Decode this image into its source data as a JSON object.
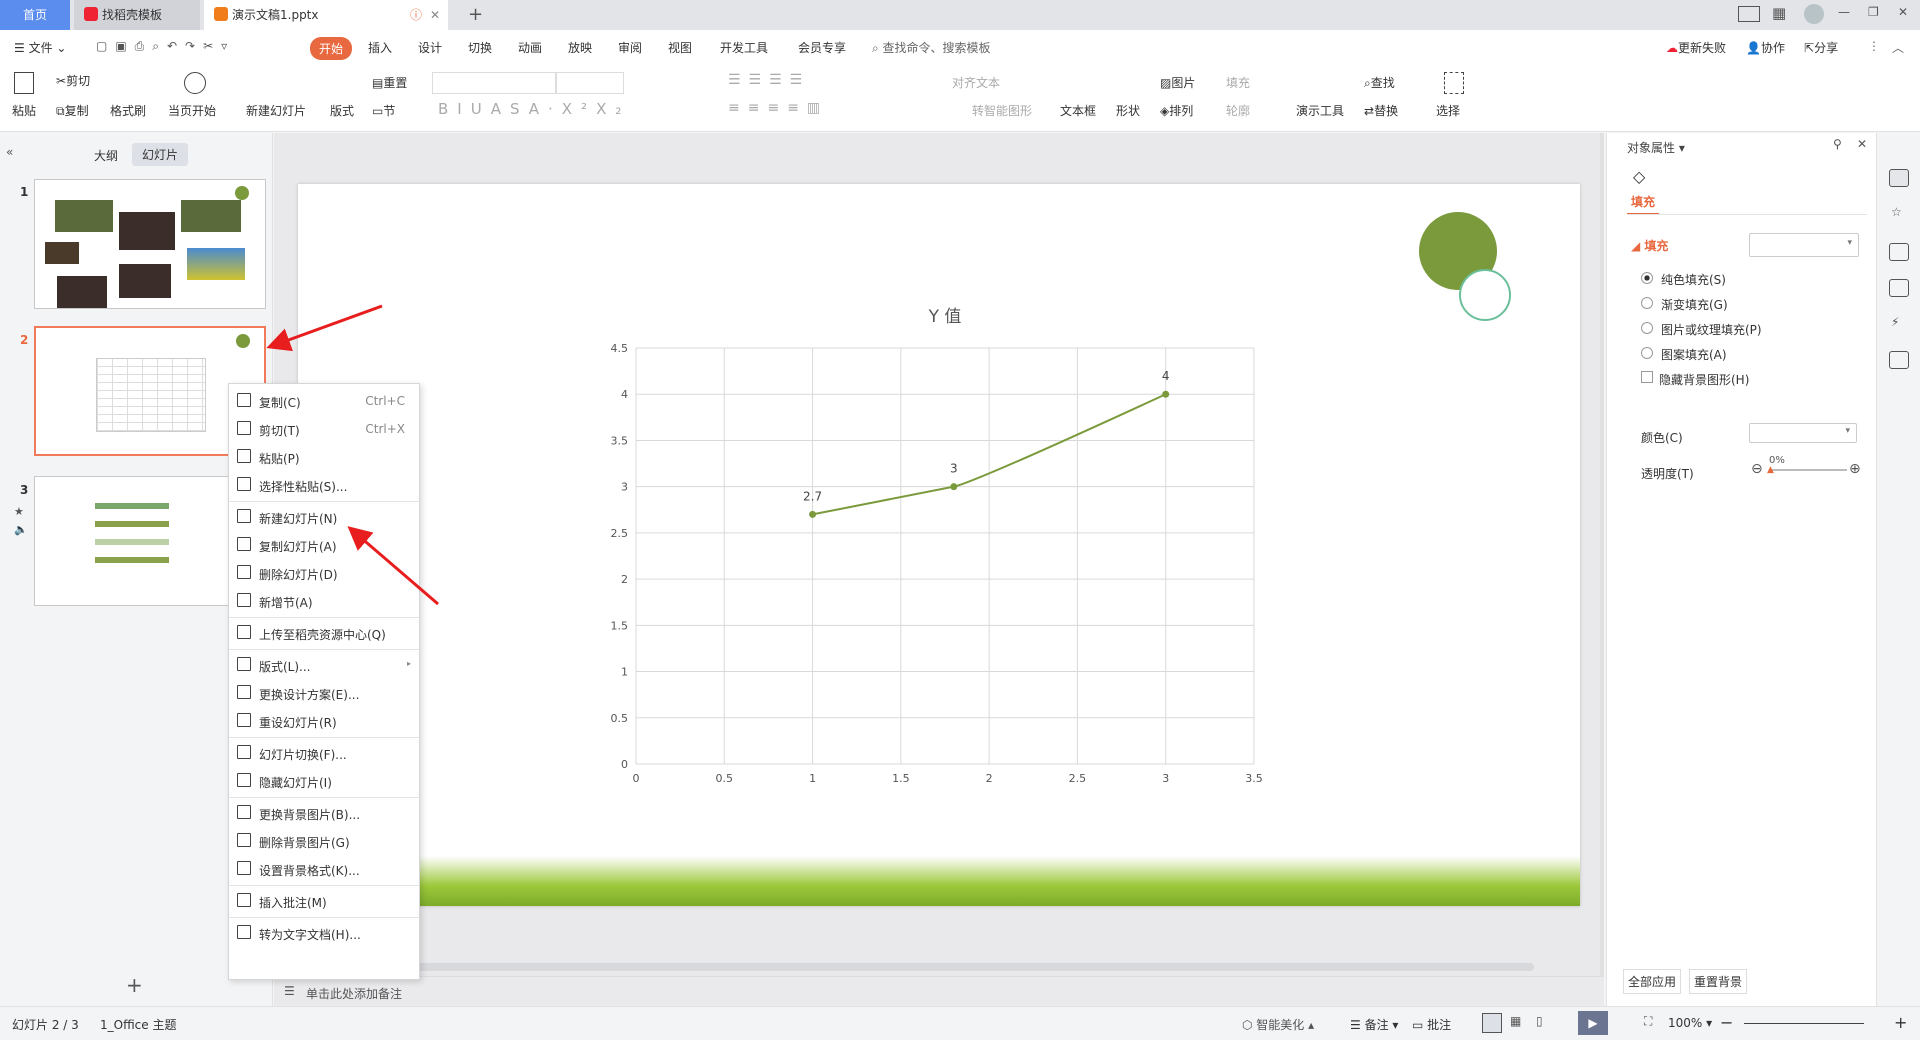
{
  "tabs": [
    {
      "label": "首页"
    },
    {
      "label": "找稻壳模板"
    },
    {
      "label": "演示文稿1.pptx"
    }
  ],
  "menu": {
    "file": "文件",
    "items": [
      "开始",
      "插入",
      "设计",
      "切换",
      "动画",
      "放映",
      "审阅",
      "视图",
      "开发工具",
      "会员专享"
    ],
    "search": "查找命令、搜索模板",
    "update": "更新失败",
    "collab": "协作",
    "share": "分享"
  },
  "ribbon": {
    "paste": "粘贴",
    "cut": "剪切",
    "copy": "复制",
    "format_painter": "格式刷",
    "from_current": "当页开始",
    "new_slide": "新建幻灯片",
    "layout": "版式",
    "reset": "重置",
    "section": "节",
    "align_text": "对齐文本",
    "smartart": "转智能图形",
    "textbox": "文本框",
    "shape": "形状",
    "picture": "图片",
    "arrange": "排列",
    "fill": "填充",
    "outline": "轮廓",
    "present_tools": "演示工具",
    "find": "查找",
    "replace": "替换",
    "select": "选择"
  },
  "left": {
    "tab_outline": "大纲",
    "tab_slides": "幻灯片",
    "slides": [
      "1",
      "2",
      "3"
    ],
    "selected": 2
  },
  "chart_data": {
    "type": "line",
    "title": "Y 值",
    "x": [
      1,
      1.8,
      3
    ],
    "y": [
      2.7,
      3,
      4
    ],
    "data_labels": [
      "2.7",
      "3",
      "4"
    ],
    "xlim": [
      0,
      3.5
    ],
    "ylim": [
      0,
      4.5
    ],
    "xticks": [
      "0",
      "0.5",
      "1",
      "1.5",
      "2",
      "2.5",
      "3",
      "3.5"
    ],
    "yticks": [
      "0",
      "0.5",
      "1",
      "1.5",
      "2",
      "2.5",
      "3",
      "3.5",
      "4",
      "4.5"
    ],
    "grid": true,
    "color": "#7a9a3c"
  },
  "context_menu": [
    {
      "label": "复制(C)",
      "shortcut": "Ctrl+C",
      "icon": "copy-icon"
    },
    {
      "label": "剪切(T)",
      "shortcut": "Ctrl+X",
      "icon": "cut-icon"
    },
    {
      "label": "粘贴(P)",
      "shortcut": "",
      "icon": "paste-icon"
    },
    {
      "label": "选择性粘贴(S)...",
      "shortcut": "",
      "icon": "paste-special-icon"
    },
    {
      "label": "新建幻灯片(N)",
      "shortcut": "",
      "icon": "new-slide-icon"
    },
    {
      "label": "复制幻灯片(A)",
      "shortcut": "",
      "icon": "duplicate-slide-icon"
    },
    {
      "label": "删除幻灯片(D)",
      "shortcut": "",
      "icon": "delete-slide-icon"
    },
    {
      "label": "新增节(A)",
      "shortcut": "",
      "icon": "add-section-icon"
    },
    {
      "label": "上传至稻壳资源中心(Q)",
      "shortcut": "",
      "icon": "upload-icon"
    },
    {
      "label": "版式(L)...",
      "shortcut": "",
      "icon": "layout-icon"
    },
    {
      "label": "更换设计方案(E)...",
      "shortcut": "",
      "icon": "design-icon"
    },
    {
      "label": "重设幻灯片(R)",
      "shortcut": "",
      "icon": "reset-slide-icon"
    },
    {
      "label": "幻灯片切换(F)...",
      "shortcut": "",
      "icon": "transition-icon"
    },
    {
      "label": "隐藏幻灯片(I)",
      "shortcut": "",
      "icon": "hide-slide-icon"
    },
    {
      "label": "更换背景图片(B)...",
      "shortcut": "",
      "icon": "change-bg-icon"
    },
    {
      "label": "删除背景图片(G)",
      "shortcut": "",
      "icon": "delete-bg-icon"
    },
    {
      "label": "设置背景格式(K)...",
      "shortcut": "",
      "icon": "bg-format-icon"
    },
    {
      "label": "插入批注(M)",
      "shortcut": "",
      "icon": "comment-icon"
    },
    {
      "label": "转为文字文档(H)...",
      "shortcut": "",
      "icon": "to-doc-icon"
    }
  ],
  "notes_placeholder": "单击此处添加备注",
  "panel": {
    "title": "对象属性",
    "tab": "填充",
    "section": "填充",
    "options": [
      "纯色填充(S)",
      "渐变填充(G)",
      "图片或纹理填充(P)",
      "图案填充(A)"
    ],
    "selected_option": 0,
    "hide_bg": "隐藏背景图形(H)",
    "color_label": "颜色(C)",
    "transparency_label": "透明度(T)",
    "transparency": "0%",
    "apply_all": "全部应用",
    "reset_bg": "重置背景"
  },
  "status": {
    "slide": "幻灯片 2 / 3",
    "theme": "1_Office 主题",
    "beautify": "智能美化",
    "notes": "备注",
    "comments": "批注",
    "zoom": "100%"
  },
  "colors": {
    "accent": "#e8683f",
    "tab_active": "#ffffff",
    "home_tab": "#5b8def",
    "slide_green": "#7a9a3c"
  }
}
